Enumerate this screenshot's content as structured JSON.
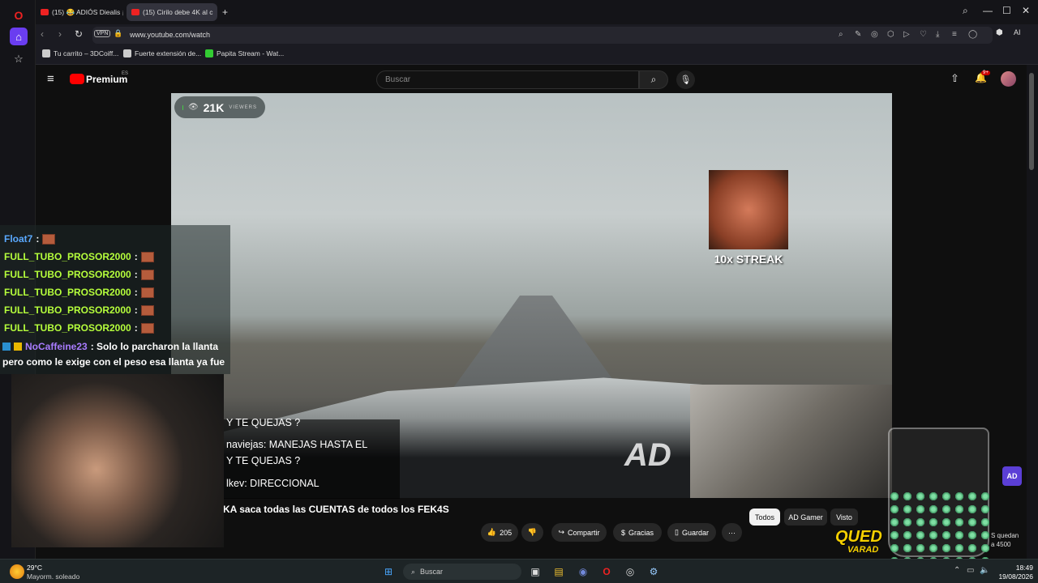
{
  "browser": {
    "tabs": [
      {
        "label": "(15) 😂 ADIÓS Diealis ¡FE"
      },
      {
        "label": "(15) Cirilo debe 4K al c"
      }
    ],
    "new_tab": "+",
    "url": "www.youtube.com/watch",
    "vpn_label": "VPN",
    "ai_label": "AI",
    "bookmarks": [
      {
        "label": "Tu carrito – 3DCoiff..."
      },
      {
        "label": "Fuerte extensión de..."
      },
      {
        "label": "Papita Stream - Wat..."
      }
    ]
  },
  "youtube": {
    "logo": "Premium",
    "region": "ES",
    "search_placeholder": "Buscar",
    "notif_badge": "9+"
  },
  "stream": {
    "viewers": "21K",
    "viewers_label": "VIEWERS",
    "streak": "10x STREAK",
    "watermark": "AD",
    "video_chat": [
      "Y TE QUEJAS ?",
      "naviejas: MANEJAS HASTA EL",
      "Y TE QUEJAS ?",
      "lkev: DIRECCIONAL"
    ],
    "caption": "KA saca todas las CUENTAS de todos los FEK4S",
    "qued_text": "QUED",
    "qued_sub": "VARAD",
    "side_text": [
      "S quedan",
      "a 4500"
    ]
  },
  "chat": {
    "lines": [
      {
        "user": "Float7",
        "color": "#5aa9ff"
      },
      {
        "user": "FULL_TUBO_PROSOR2000",
        "color": "#b6ff3c"
      },
      {
        "user": "FULL_TUBO_PROSOR2000",
        "color": "#b6ff3c"
      },
      {
        "user": "FULL_TUBO_PROSOR2000",
        "color": "#b6ff3c"
      },
      {
        "user": "FULL_TUBO_PROSOR2000",
        "color": "#b6ff3c"
      },
      {
        "user": "FULL_TUBO_PROSOR2000",
        "color": "#b6ff3c"
      }
    ],
    "msg_user": "NoCaffeine23",
    "msg_user_color": "#a97cff",
    "msg_text_1": ": Solo lo parcharon la llanta",
    "msg_text_2": "pero como le exige con el peso esa llanta ya fue"
  },
  "actions": {
    "likes": "205",
    "share": "Compartir",
    "thanks": "Gracias",
    "save": "Guardar",
    "more": "···"
  },
  "chips": [
    "Todos",
    "AD Gamer",
    "Visto"
  ],
  "taskbar": {
    "weather_temp": "29°C",
    "weather_desc": "Mayorm. soleado",
    "search": "Buscar",
    "time": "18:49",
    "date": "19/08/2026"
  }
}
